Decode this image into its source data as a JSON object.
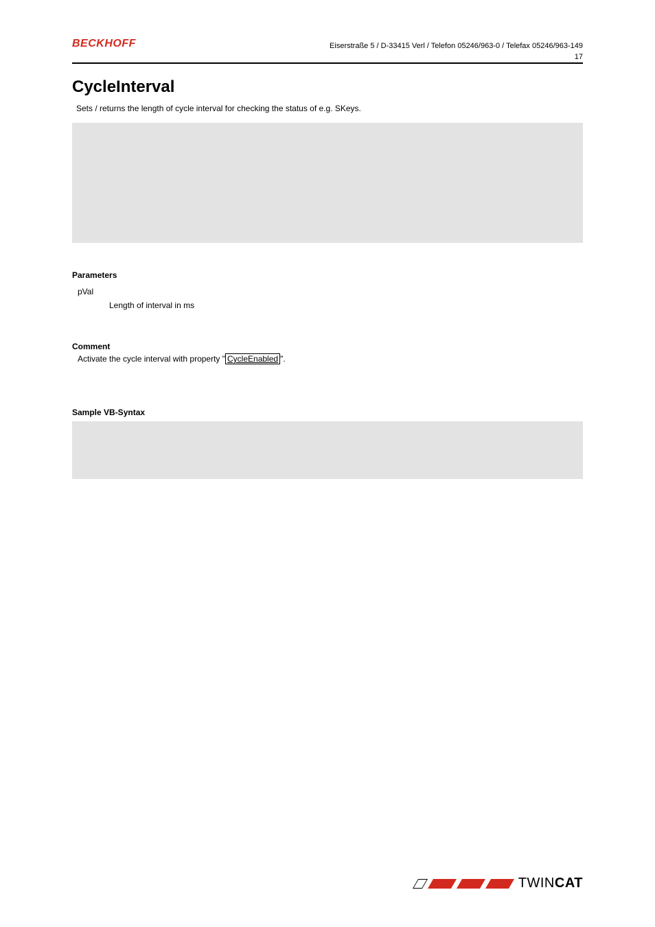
{
  "header": {
    "brand": "BECKHOFF",
    "address": "Eiserstraße 5 / D-33415 Verl / Telefon 05246/963-0 / Telefax 05246/963-149",
    "page_number": "17"
  },
  "title": "CycleInterval",
  "intro": "Sets / returns the length of cycle interval for checking the status of e.g. SKeys.",
  "sections": {
    "parameters_heading": "Parameters",
    "param_name": "pVal",
    "param_desc": "Length of interval in ms",
    "comment_heading": "Comment",
    "comment_prefix": "Activate the cycle interval with property \"",
    "comment_link": "CycleEnabled",
    "comment_suffix": "\".",
    "syntax_heading": "Sample VB-Syntax"
  },
  "footer": {
    "twin": "TWIN",
    "cat": "CAT"
  }
}
